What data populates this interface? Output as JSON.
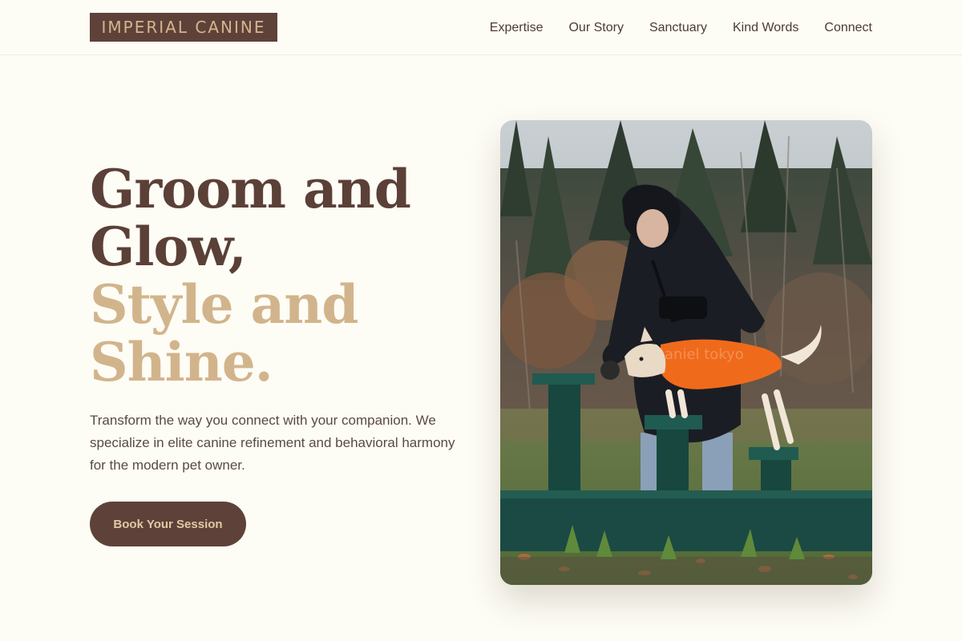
{
  "brand": {
    "logo_text": "IMPERIAL CANINE"
  },
  "nav": {
    "items": [
      {
        "label": "Expertise"
      },
      {
        "label": "Our Story"
      },
      {
        "label": "Sanctuary"
      },
      {
        "label": "Kind Words"
      },
      {
        "label": "Connect"
      }
    ]
  },
  "hero": {
    "title_line1": "Groom and Glow,",
    "title_line2": "Style and Shine.",
    "description": "Transform the way you connect with your companion. We specialize in elite canine refinement and behavioral harmony for the modern pet owner.",
    "cta_label": "Book Your Session"
  },
  "photo": {
    "icon": "hero-photo-dog-training",
    "caption_text": "aniel tokyo"
  },
  "colors": {
    "background": "#fdfcf5",
    "brown": "#5e4239",
    "tan": "#d2b48c"
  }
}
